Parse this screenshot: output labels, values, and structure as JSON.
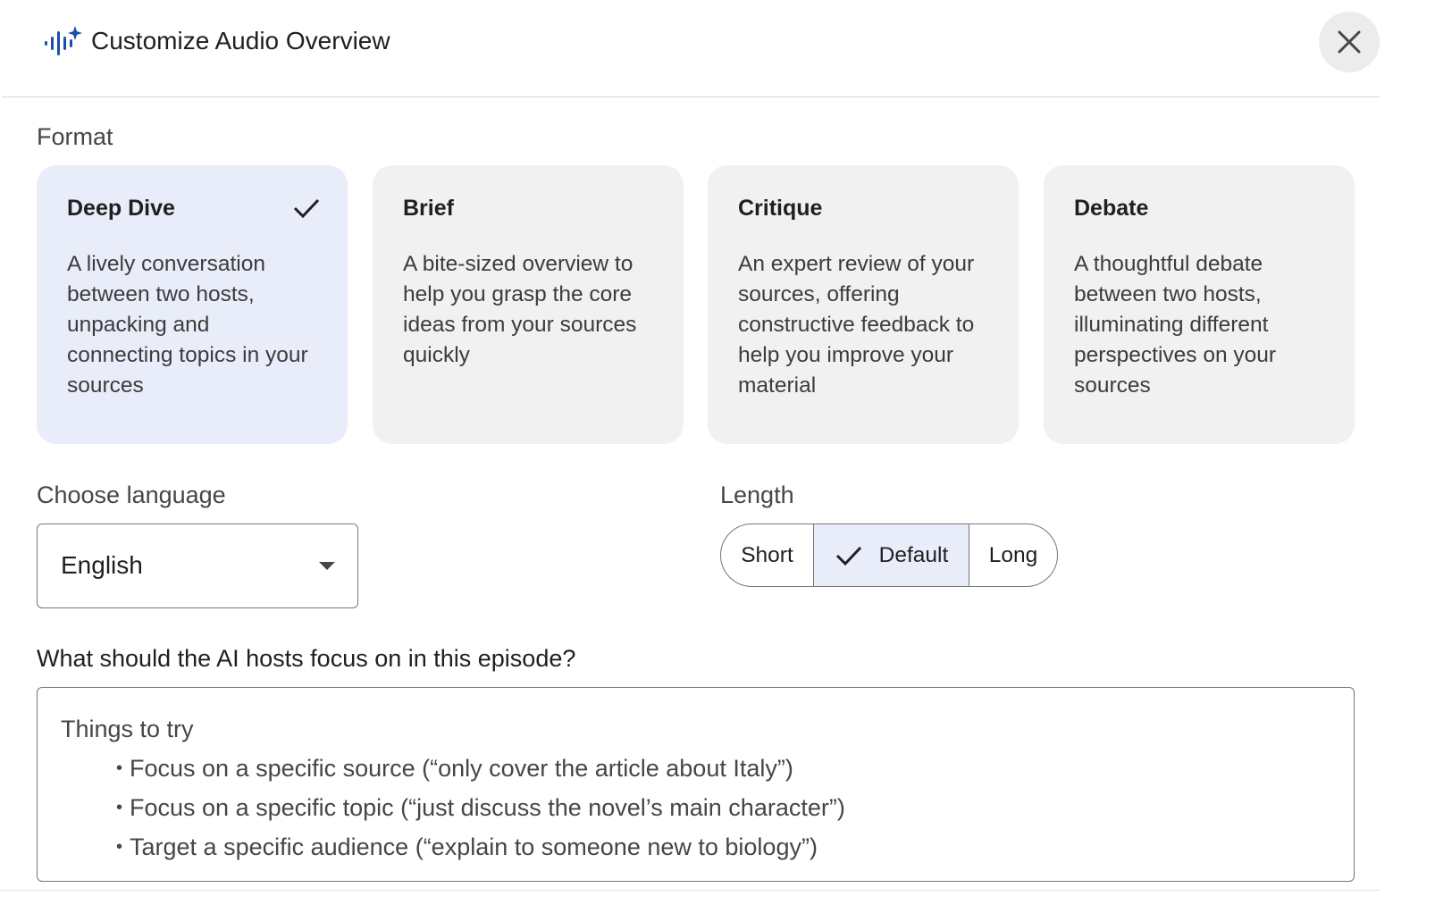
{
  "header": {
    "title": "Customize Audio Overview",
    "icon": "audio-sparkle-icon",
    "close_icon": "close-icon"
  },
  "format": {
    "label": "Format",
    "cards": [
      {
        "title": "Deep Dive",
        "description": "A lively conversation between two hosts, unpacking and connecting topics in your sources",
        "selected": true
      },
      {
        "title": "Brief",
        "description": "A bite-sized overview to help you grasp the core ideas from your sources quickly",
        "selected": false
      },
      {
        "title": "Critique",
        "description": "An expert review of your sources, offering constructive feedback to help you improve your material",
        "selected": false
      },
      {
        "title": "Debate",
        "description": "A thoughtful debate between two hosts, illuminating different perspectives on your sources",
        "selected": false
      }
    ]
  },
  "language": {
    "label": "Choose language",
    "value": "English"
  },
  "length": {
    "label": "Length",
    "options": [
      "Short",
      "Default",
      "Long"
    ],
    "selected": "Default"
  },
  "focus": {
    "label": "What should the AI hosts focus on in this episode?",
    "placeholder_title": "Things to try",
    "placeholder_items": [
      "Focus on a specific source (“only cover the article about Italy”)",
      "Focus on a specific topic (“just discuss the novel’s main character”)",
      "Target a specific audience (“explain to someone new to biology”)"
    ]
  },
  "colors": {
    "selected_bg": "#e9edf9",
    "card_bg": "#f1f1f1",
    "icon_blue": "#1a4fa8",
    "border": "#747775"
  }
}
